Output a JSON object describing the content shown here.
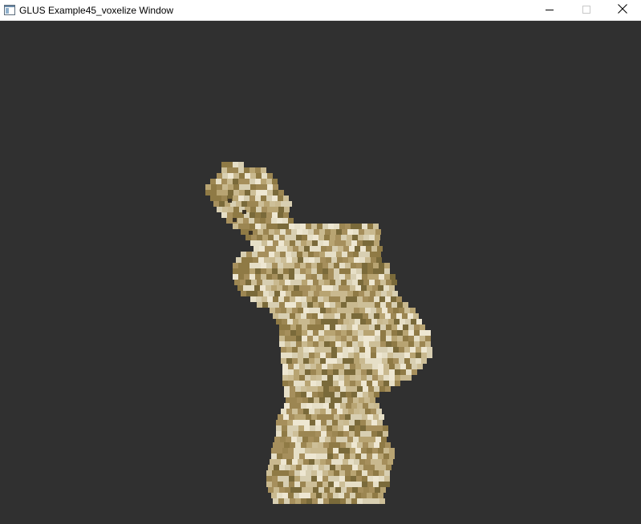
{
  "window": {
    "title": "GLUS Example45_voxelize Window",
    "icons": {
      "app": "app-window-icon",
      "minimize": "minimize-icon",
      "maximize": "maximize-icon",
      "close": "close-icon"
    }
  },
  "render": {
    "background_color": "#303030",
    "model_palette": [
      "#d8cfb2",
      "#c9b98f",
      "#b8a472",
      "#a68f5c",
      "#8f7a45",
      "#e6dfc7",
      "#9c8652",
      "#7a6a3a",
      "#cdbf98",
      "#eee7d2"
    ],
    "model_description_icon": "voxelized-model"
  }
}
